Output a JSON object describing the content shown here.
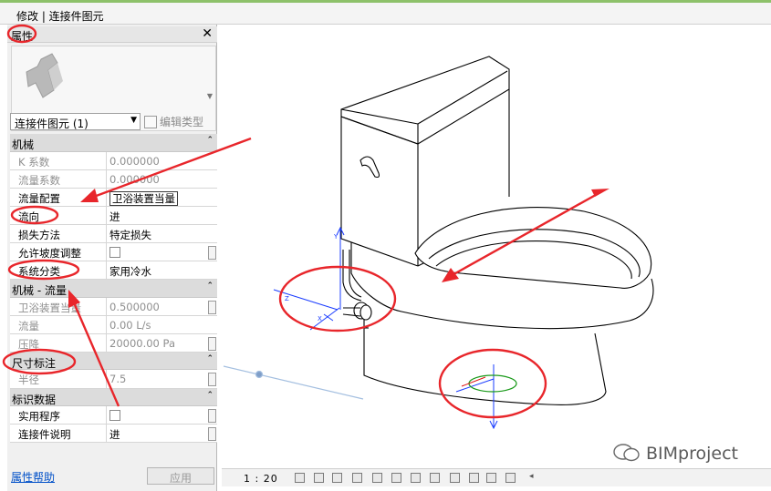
{
  "window": {
    "title": "修改 | 连接件图元"
  },
  "properties_panel": {
    "title": "属性",
    "close_glyph": "✕",
    "selector_value": "连接件图元 (1)",
    "edit_type_label": "编辑类型",
    "help_link": "属性帮助",
    "apply_button": "应用",
    "categories": [
      {
        "name": "机械",
        "rows": [
          {
            "key": "K 系数",
            "value": "0.000000",
            "greyed": true
          },
          {
            "key": "流量系数",
            "value": "0.000000",
            "greyed": true
          },
          {
            "key": "流量配置",
            "value": "卫浴装置当量",
            "greyed": false
          },
          {
            "key": "流向",
            "value": "进",
            "greyed": false
          },
          {
            "key": "损失方法",
            "value": "特定损失",
            "greyed": false
          },
          {
            "key": "允许坡度调整",
            "value": "",
            "greyed": false,
            "checkbox": true
          },
          {
            "key": "系统分类",
            "value": "家用冷水",
            "greyed": false
          }
        ]
      },
      {
        "name": "机械 - 流量",
        "rows": [
          {
            "key": "卫浴装置当量",
            "value": "0.500000",
            "greyed": true
          },
          {
            "key": "流量",
            "value": "0.00 L/s",
            "greyed": true
          },
          {
            "key": "压降",
            "value": "20000.00 Pa",
            "greyed": true
          }
        ]
      },
      {
        "name": "尺寸标注",
        "rows": [
          {
            "key": "半径",
            "value": "7.5",
            "greyed": true
          }
        ]
      },
      {
        "name": "标识数据",
        "rows": [
          {
            "key": "实用程序",
            "value": "",
            "greyed": false,
            "checkbox": true
          },
          {
            "key": "连接件说明",
            "value": "进",
            "greyed": false
          }
        ]
      }
    ]
  },
  "view": {
    "scale": "1 : 20"
  },
  "watermark": {
    "text": "BIMproject"
  },
  "colors": {
    "annotation_red": "#e8262b",
    "accent_green": "#8dc16a",
    "model_line": "#000000",
    "connector_blue": "#1a3cff",
    "connector_green": "#1a9a1a"
  }
}
